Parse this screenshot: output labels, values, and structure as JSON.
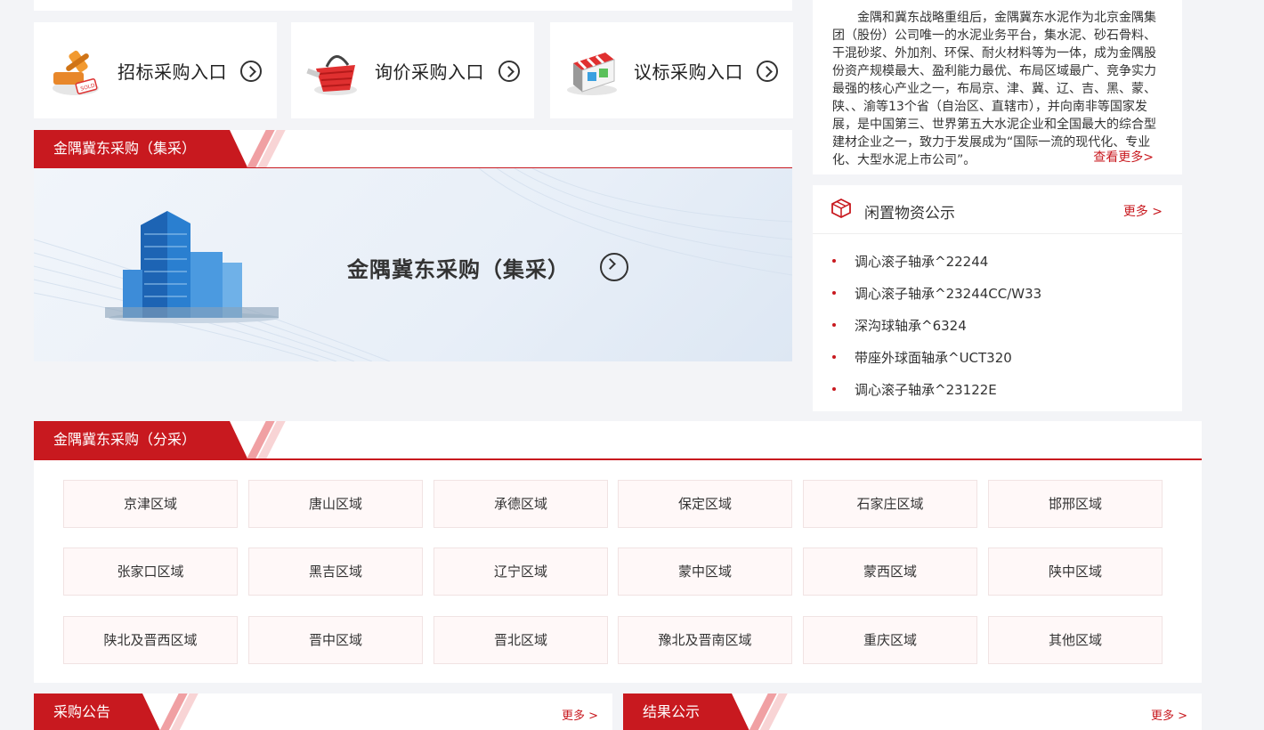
{
  "entries": [
    {
      "label": "招标采购入口",
      "icon": "auction-hammer-icon"
    },
    {
      "label": "询价采购入口",
      "icon": "shopping-basket-icon"
    },
    {
      "label": "议标采购入口",
      "icon": "storefront-icon"
    }
  ],
  "central": {
    "section_title": "金隅冀东采购（集采）",
    "banner_title": "金隅冀东采购（集采）"
  },
  "intro": {
    "text": "金隅和冀东战略重组后，金隅冀东水泥作为北京金隅集团（股份）公司唯一的水泥业务平台，集水泥、砂石骨料、干混砂浆、外加剂、环保、耐火材料等为一体，成为金隅股份资产规模最大、盈利能力最优、布局区域最广、竞争实力最强的核心产业之一，布局京、津、冀、辽、吉、黑、蒙、陕、、渝等13个省（自治区、直辖市），并向南非等国家发展，是中国第三、世界第五大水泥企业和全国最大的综合型建材企业之一，致力于发展成为“国际一流的现代化、专业化、大型水泥上市公司”。",
    "more": "查看更多>"
  },
  "idle": {
    "title": "闲置物资公示",
    "more": "更多 >",
    "items": [
      "调心滚子轴承^22244",
      "调心滚子轴承^23244CC/W33",
      "深沟球轴承^6324",
      "带座外球面轴承^UCT320",
      "调心滚子轴承^23122E"
    ]
  },
  "regional": {
    "section_title": "金隅冀东采购（分采）",
    "regions": [
      "京津区域",
      "唐山区域",
      "承德区域",
      "保定区域",
      "石家庄区域",
      "邯邢区域",
      "张家口区域",
      "黑吉区域",
      "辽宁区域",
      "蒙中区域",
      "蒙西区域",
      "陕中区域",
      "陕北及晋西区域",
      "晋中区域",
      "晋北区域",
      "豫北及晋南区域",
      "重庆区域",
      "其他区域"
    ]
  },
  "announcements": {
    "title": "采购公告",
    "more": "更多 >"
  },
  "results": {
    "title": "结果公示",
    "more": "更多 >"
  },
  "colors": {
    "brand_red": "#c8191f",
    "page_bg": "#f3f4f7"
  }
}
